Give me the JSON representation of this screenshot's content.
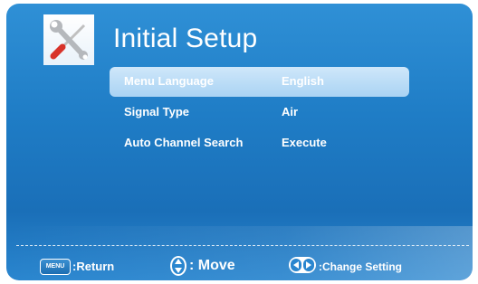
{
  "header": {
    "title": "Initial Setup",
    "icon": "tools-icon"
  },
  "menu": {
    "items": [
      {
        "label": "Menu Language",
        "value": "English",
        "selected": true
      },
      {
        "label": "Signal Type",
        "value": "Air",
        "selected": false
      },
      {
        "label": "Auto Channel Search",
        "value": "Execute",
        "selected": false
      }
    ]
  },
  "footer": {
    "menu_key": "MENU",
    "return_label": ":Return",
    "move_label": ": Move",
    "change_label": ":Change Setting"
  },
  "colors": {
    "background": "#1f7dc6",
    "selection": "#bde0f8",
    "text": "#ffffff"
  }
}
